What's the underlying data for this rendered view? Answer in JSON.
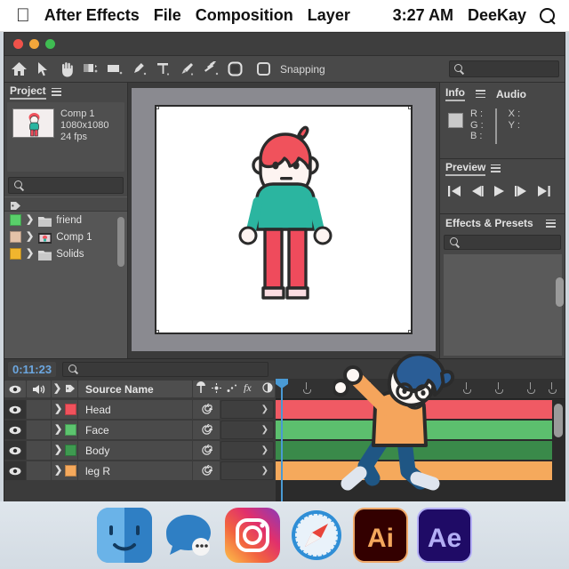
{
  "menubar": {
    "apple_icon": "apple-logo-icon",
    "app_name": "After Effects",
    "items": [
      {
        "label": "File"
      },
      {
        "label": "Composition"
      },
      {
        "label": "Layer"
      }
    ],
    "time": "3:27 AM",
    "user": "DeeKay",
    "search_icon": "search-icon"
  },
  "window": {
    "close_label": "close",
    "minimize_label": "minimize",
    "zoom_label": "zoom"
  },
  "toolbar": {
    "tools": [
      {
        "name": "home-icon",
        "label": "Home"
      },
      {
        "name": "selection-arrow-icon",
        "label": "Selection Tool"
      },
      {
        "name": "hand-icon",
        "label": "Hand Tool"
      },
      {
        "name": "rotation-icon",
        "label": "Rotation Tool"
      },
      {
        "name": "region-of-interest-icon",
        "label": "Region of Interest"
      },
      {
        "name": "pen-icon",
        "label": "Pen Tool"
      },
      {
        "name": "text-icon",
        "label": "Type Tool"
      },
      {
        "name": "brush-icon",
        "label": "Brush Tool"
      },
      {
        "name": "clone-stamp-icon",
        "label": "Clone Stamp Tool"
      },
      {
        "name": "shape-icon",
        "label": "Shape Tool"
      }
    ],
    "snapping_label": "Snapping",
    "search_icon": "search-icon",
    "search_value": "",
    "search_placeholder": ""
  },
  "project": {
    "title": "Project",
    "menu_icon": "panel-menu-icon",
    "comp": {
      "name": "Comp 1",
      "resolution": "1080x1080",
      "framerate": "24 fps",
      "thumbnail": "comp-thumbnail"
    },
    "search_value": "",
    "search_placeholder": "",
    "column_tag_icon": "tag-icon",
    "items": [
      {
        "label": "friend",
        "color": "#59d06a",
        "icon": "folder-icon"
      },
      {
        "label": "Comp 1",
        "color": "#e3c2a8",
        "icon": "composition-icon"
      },
      {
        "label": "Solids",
        "color": "#f0b52e",
        "icon": "folder-icon"
      }
    ]
  },
  "comp_viewer": {
    "canvas_bg": "#ffffff",
    "stage_bg": "#8a8a90",
    "character": {
      "name": "boy-character",
      "hair_color": "#f0525c",
      "skin_color": "#fdf4f1",
      "shirt_color": "#2bb5a0",
      "pants_color": "#ef4b5c",
      "shoe_color": "#fbdde2",
      "outline_color": "#2b2b2b"
    }
  },
  "info_panel": {
    "tabs": [
      {
        "label": "Info",
        "active": true
      },
      {
        "label": "Audio",
        "active": false
      }
    ],
    "menu_icon": "panel-menu-icon",
    "channels": [
      {
        "label": "R :",
        "value": ""
      },
      {
        "label": "G :",
        "value": ""
      },
      {
        "label": "B :",
        "value": ""
      }
    ],
    "coords": [
      {
        "label": "X :",
        "value": ""
      },
      {
        "label": "Y :",
        "value": ""
      }
    ]
  },
  "preview_panel": {
    "title": "Preview",
    "menu_icon": "panel-menu-icon",
    "buttons": [
      {
        "name": "first-frame-icon",
        "label": "First Frame"
      },
      {
        "name": "previous-frame-icon",
        "label": "Previous Frame"
      },
      {
        "name": "play-icon",
        "label": "Play"
      },
      {
        "name": "next-frame-icon",
        "label": "Next Frame"
      },
      {
        "name": "last-frame-icon",
        "label": "Last Frame"
      }
    ]
  },
  "effects_panel": {
    "title": "Effects & Presets",
    "menu_icon": "panel-menu-icon",
    "search_icon": "search-icon",
    "search_value": "",
    "search_placeholder": ""
  },
  "timeline": {
    "timecode": "0:11:23",
    "timecode_color": "#6ca7e0",
    "search_value": "",
    "search_placeholder": "",
    "search_icon": "search-icon",
    "columns": {
      "eye_icon": "visibility-icon",
      "audio_icon": "audio-icon",
      "label_icon": "label-tag-icon",
      "source_name": "Source Name",
      "switches": [
        {
          "name": "shy-icon"
        },
        {
          "name": "collapse-transformations-icon"
        },
        {
          "name": "quality-icon"
        },
        {
          "name": "effects-fx-icon"
        },
        {
          "name": "motion-blur-icon"
        }
      ]
    },
    "layers": [
      {
        "name": "Head",
        "color": "#f0525c",
        "bar_color": "#f05a64",
        "parent": "",
        "eye_on": true
      },
      {
        "name": "Face",
        "color": "#5cc46e",
        "bar_color": "#5cbf6e",
        "parent": "",
        "eye_on": true
      },
      {
        "name": "Body",
        "color": "#3e9a50",
        "bar_color": "#3a8a4a",
        "parent": "",
        "eye_on": true
      },
      {
        "name": "leg R",
        "color": "#f5a95c",
        "bar_color": "#f5a95c",
        "parent": "",
        "eye_on": true
      }
    ],
    "playhead_color": "#4a9ad4"
  },
  "overlay_character": {
    "name": "dancing-character",
    "hair_color": "#2a5d96",
    "skin_color": "#fdf8f5",
    "shirt_color": "#f5a55c",
    "pants_color": "#1f5684",
    "shoe_color": "#dfe5ee",
    "outline_color": "#2b2b2b"
  },
  "dock": {
    "apps": [
      {
        "name": "finder-icon",
        "label": "Finder"
      },
      {
        "name": "messages-icon",
        "label": "Messages"
      },
      {
        "name": "instagram-icon",
        "label": "Instagram"
      },
      {
        "name": "safari-icon",
        "label": "Safari"
      },
      {
        "name": "illustrator-icon",
        "label": "Ai"
      },
      {
        "name": "after-effects-icon",
        "label": "Ae"
      }
    ]
  }
}
